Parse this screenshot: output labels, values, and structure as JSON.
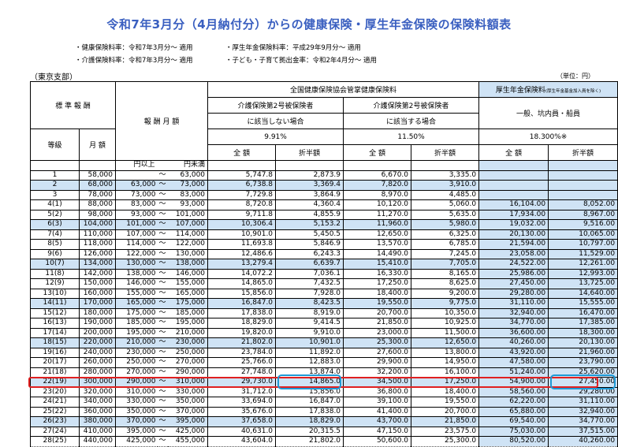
{
  "title": "令和7年3月分（4月納付分）からの健康保険・厚生年金保険の保険料額表",
  "notes_left": [
    "・健康保険料率：令和7年3月分～ 適用",
    "・介護保険料率：令和7年3月分～ 適用"
  ],
  "notes_right": [
    "・厚生年金保険料率：平成29年9月分～ 適用",
    "・子ども・子育て拠出金率：令和2年4月分～ 適用"
  ],
  "branch": "（東京支部）",
  "unit": "（単位：円）",
  "header": {
    "standard_remuneration": "標 準 報 酬",
    "remuneration_monthly": "報 酬 月 額",
    "grade": "等級",
    "monthly_amount": "月 額",
    "kyokai": "全国健康保険協会管掌健康保険料",
    "pension": "厚生年金保険料",
    "pension_note": "(厚生年金基金加入員を除く)",
    "no_care_1": "介護保険第2号被保険者",
    "no_care_2": "に該当しない場合",
    "care_1": "介護保険第2号被保険者",
    "care_2": "に該当する場合",
    "pension_sub": "一般、坑内員・船員",
    "rate_no_care": "9.91%",
    "rate_care": "11.50%",
    "rate_pension": "18.300%※",
    "full": "全 額",
    "half": "折半額",
    "lower": "円以上",
    "upper": "円未満"
  },
  "rows": [
    {
      "g": "1",
      "m": "58,000",
      "lo": "",
      "t": "～",
      "hi": "63,000",
      "a": "5,747.8",
      "b": "2,873.9",
      "c": "6,670.0",
      "d": "3,335.0",
      "e": "",
      "f": ""
    },
    {
      "g": "2",
      "m": "68,000",
      "lo": "63,000",
      "t": "～",
      "hi": "73,000",
      "a": "6,738.8",
      "b": "3,369.4",
      "c": "7,820.0",
      "d": "3,910.0",
      "e": "",
      "f": ""
    },
    {
      "g": "3",
      "m": "78,000",
      "lo": "73,000",
      "t": "～",
      "hi": "83,000",
      "a": "7,729.8",
      "b": "3,864.9",
      "c": "8,970.0",
      "d": "4,485.0",
      "e": "",
      "f": ""
    },
    {
      "g": "4(1)",
      "m": "88,000",
      "lo": "83,000",
      "t": "～",
      "hi": "93,000",
      "a": "8,720.8",
      "b": "4,360.4",
      "c": "10,120.0",
      "d": "5,060.0",
      "e": "16,104.00",
      "f": "8,052.00"
    },
    {
      "g": "5(2)",
      "m": "98,000",
      "lo": "93,000",
      "t": "～",
      "hi": "101,000",
      "a": "9,711.8",
      "b": "4,855.9",
      "c": "11,270.0",
      "d": "5,635.0",
      "e": "17,934.00",
      "f": "8,967.00"
    },
    {
      "g": "6(3)",
      "m": "104,000",
      "lo": "101,000",
      "t": "～",
      "hi": "107,000",
      "a": "10,306.4",
      "b": "5,153.2",
      "c": "11,960.0",
      "d": "5,980.0",
      "e": "19,032.00",
      "f": "9,516.00"
    },
    {
      "g": "7(4)",
      "m": "110,000",
      "lo": "107,000",
      "t": "～",
      "hi": "114,000",
      "a": "10,901.0",
      "b": "5,450.5",
      "c": "12,650.0",
      "d": "6,325.0",
      "e": "20,130.00",
      "f": "10,065.00"
    },
    {
      "g": "8(5)",
      "m": "118,000",
      "lo": "114,000",
      "t": "～",
      "hi": "122,000",
      "a": "11,693.8",
      "b": "5,846.9",
      "c": "13,570.0",
      "d": "6,785.0",
      "e": "21,594.00",
      "f": "10,797.00"
    },
    {
      "g": "9(6)",
      "m": "126,000",
      "lo": "122,000",
      "t": "～",
      "hi": "130,000",
      "a": "12,486.6",
      "b": "6,243.3",
      "c": "14,490.0",
      "d": "7,245.0",
      "e": "23,058.00",
      "f": "11,529.00"
    },
    {
      "g": "10(7)",
      "m": "134,000",
      "lo": "130,000",
      "t": "～",
      "hi": "138,000",
      "a": "13,279.4",
      "b": "6,639.7",
      "c": "15,410.0",
      "d": "7,705.0",
      "e": "24,522.00",
      "f": "12,261.00"
    },
    {
      "g": "11(8)",
      "m": "142,000",
      "lo": "138,000",
      "t": "～",
      "hi": "146,000",
      "a": "14,072.2",
      "b": "7,036.1",
      "c": "16,330.0",
      "d": "8,165.0",
      "e": "25,986.00",
      "f": "12,993.00"
    },
    {
      "g": "12(9)",
      "m": "150,000",
      "lo": "146,000",
      "t": "～",
      "hi": "155,000",
      "a": "14,865.0",
      "b": "7,432.5",
      "c": "17,250.0",
      "d": "8,625.0",
      "e": "27,450.00",
      "f": "13,725.00"
    },
    {
      "g": "13(10)",
      "m": "160,000",
      "lo": "155,000",
      "t": "～",
      "hi": "165,000",
      "a": "15,856.0",
      "b": "7,928.0",
      "c": "18,400.0",
      "d": "9,200.0",
      "e": "29,280.00",
      "f": "14,640.00"
    },
    {
      "g": "14(11)",
      "m": "170,000",
      "lo": "165,000",
      "t": "～",
      "hi": "175,000",
      "a": "16,847.0",
      "b": "8,423.5",
      "c": "19,550.0",
      "d": "9,775.0",
      "e": "31,110.00",
      "f": "15,555.00"
    },
    {
      "g": "15(12)",
      "m": "180,000",
      "lo": "175,000",
      "t": "～",
      "hi": "185,000",
      "a": "17,838.0",
      "b": "8,919.0",
      "c": "20,700.0",
      "d": "10,350.0",
      "e": "32,940.00",
      "f": "16,470.00"
    },
    {
      "g": "16(13)",
      "m": "190,000",
      "lo": "185,000",
      "t": "～",
      "hi": "195,000",
      "a": "18,829.0",
      "b": "9,414.5",
      "c": "21,850.0",
      "d": "10,925.0",
      "e": "34,770.00",
      "f": "17,385.00"
    },
    {
      "g": "17(14)",
      "m": "200,000",
      "lo": "195,000",
      "t": "～",
      "hi": "210,000",
      "a": "19,820.0",
      "b": "9,910.0",
      "c": "23,000.0",
      "d": "11,500.0",
      "e": "36,600.00",
      "f": "18,300.00"
    },
    {
      "g": "18(15)",
      "m": "220,000",
      "lo": "210,000",
      "t": "～",
      "hi": "230,000",
      "a": "21,802.0",
      "b": "10,901.0",
      "c": "25,300.0",
      "d": "12,650.0",
      "e": "40,260.00",
      "f": "20,130.00"
    },
    {
      "g": "19(16)",
      "m": "240,000",
      "lo": "230,000",
      "t": "～",
      "hi": "250,000",
      "a": "23,784.0",
      "b": "11,892.0",
      "c": "27,600.0",
      "d": "13,800.0",
      "e": "43,920.00",
      "f": "21,960.00"
    },
    {
      "g": "20(17)",
      "m": "260,000",
      "lo": "250,000",
      "t": "～",
      "hi": "270,000",
      "a": "25,766.0",
      "b": "12,883.0",
      "c": "29,900.0",
      "d": "14,950.0",
      "e": "47,580.00",
      "f": "23,790.00"
    },
    {
      "g": "21(18)",
      "m": "280,000",
      "lo": "270,000",
      "t": "～",
      "hi": "290,000",
      "a": "27,748.0",
      "b": "13,874.0",
      "c": "32,200.0",
      "d": "16,100.0",
      "e": "51,240.00",
      "f": "25,620.00"
    },
    {
      "g": "22(19)",
      "m": "300,000",
      "lo": "290,000",
      "t": "～",
      "hi": "310,000",
      "a": "29,730.0",
      "b": "14,865.0",
      "c": "34,500.0",
      "d": "17,250.0",
      "e": "54,900.00",
      "f": "27,450.00"
    },
    {
      "g": "23(20)",
      "m": "320,000",
      "lo": "310,000",
      "t": "～",
      "hi": "330,000",
      "a": "31,712.0",
      "b": "15,856.0",
      "c": "36,800.0",
      "d": "18,400.0",
      "e": "58,560.00",
      "f": "29,280.00"
    },
    {
      "g": "24(21)",
      "m": "340,000",
      "lo": "330,000",
      "t": "～",
      "hi": "350,000",
      "a": "33,694.0",
      "b": "16,847.0",
      "c": "39,100.0",
      "d": "19,550.0",
      "e": "62,220.00",
      "f": "31,110.00"
    },
    {
      "g": "25(22)",
      "m": "360,000",
      "lo": "350,000",
      "t": "～",
      "hi": "370,000",
      "a": "35,676.0",
      "b": "17,838.0",
      "c": "41,400.0",
      "d": "20,700.0",
      "e": "65,880.00",
      "f": "32,940.00"
    },
    {
      "g": "26(23)",
      "m": "380,000",
      "lo": "370,000",
      "t": "～",
      "hi": "395,000",
      "a": "37,658.0",
      "b": "18,829.0",
      "c": "43,700.0",
      "d": "21,850.0",
      "e": "69,540.00",
      "f": "34,770.00"
    },
    {
      "g": "27(24)",
      "m": "410,000",
      "lo": "395,000",
      "t": "～",
      "hi": "425,000",
      "a": "40,631.0",
      "b": "20,315.5",
      "c": "47,150.0",
      "d": "23,575.0",
      "e": "75,030.00",
      "f": "37,515.00"
    },
    {
      "g": "28(25)",
      "m": "440,000",
      "lo": "425,000",
      "t": "～",
      "hi": "455,000",
      "a": "43,604.0",
      "b": "21,802.0",
      "c": "50,600.0",
      "d": "25,300.0",
      "e": "80,520.00",
      "f": "40,260.00"
    }
  ],
  "shaded_rows": [
    1,
    5,
    9,
    13,
    17,
    21,
    25
  ],
  "highlighted_row": 21,
  "colors": {
    "title": "#3a5fc0",
    "shade": "#cfe3f5",
    "row_highlight": "#e02020",
    "cell_highlight": "#1f9ad6"
  }
}
